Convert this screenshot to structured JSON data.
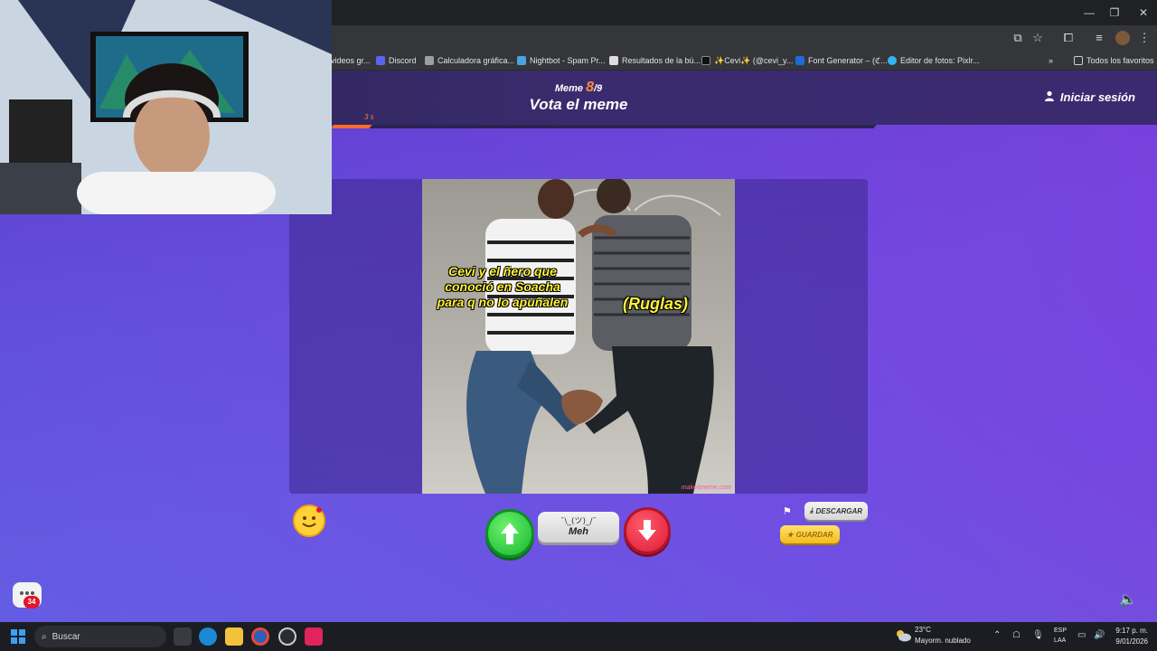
{
  "bookmarks": [
    {
      "label": "videos gr...",
      "color": "#888888"
    },
    {
      "label": "Discord",
      "color": "#5865f2"
    },
    {
      "label": "Calculadora gráfica...",
      "color": "#9e9e9e"
    },
    {
      "label": "Nightbot - Spam Pr...",
      "color": "#4aa3df"
    },
    {
      "label": "Resultados de la bú...",
      "color": "#dddddd"
    },
    {
      "label": "✨Cevi✨ (@cevi_y...",
      "color": "#111111"
    },
    {
      "label": "Font Generator – (ℭ...",
      "color": "#1e6bd6"
    },
    {
      "label": "Editor de fotos: Pixlr...",
      "color": "#35b6f2"
    }
  ],
  "bookmarks_all": "Todos los favoritos",
  "game": {
    "meme_prefix": "Meme",
    "meme_current": "8",
    "meme_total": "/9",
    "title": "Vota el meme",
    "login": "Iniciar sesión",
    "timer_label": "3 s",
    "timer_fraction": 0.07
  },
  "meme": {
    "caption_left": "Cevi y el ñero que conoció en Soacha para q no lo apuñalen",
    "caption_right": "(Ruglas)",
    "watermark": "makeitmeme.com"
  },
  "actions": {
    "meh_face": "¯\\_(ツ)_/¯",
    "meh_label": "Meh",
    "download": "DESCARGAR",
    "save": "GUARDAR",
    "chat_badge": "34"
  },
  "taskbar": {
    "search": "Buscar",
    "temp": "23°C",
    "weather": "Mayorm. nublado",
    "lang1": "ESP",
    "lang2": "LAA",
    "time": "9:17 p. m.",
    "date": "9/01/2026"
  },
  "colors": {
    "accent_orange": "#ff6a2a",
    "upvote": "#18b62f",
    "downvote": "#dd1b37",
    "save": "#f2bd1a"
  },
  "icons": {
    "upvote": "arrow-up-icon",
    "downvote": "arrow-down-icon",
    "user": "user-icon",
    "flag": "flag-icon",
    "download": "download-icon",
    "star": "star-icon",
    "sound": "speaker-icon"
  }
}
